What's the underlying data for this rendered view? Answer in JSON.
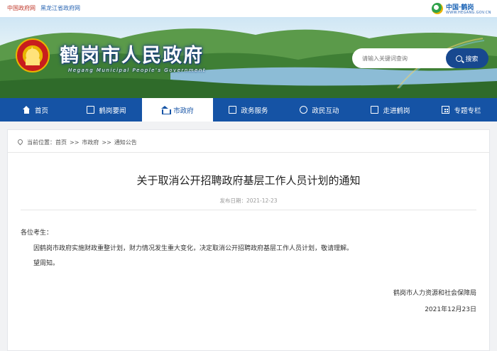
{
  "topbar": {
    "links": [
      "中国政府网",
      "黑龙江省政府网"
    ],
    "brand_name": "中国·鹤岗",
    "brand_url": "WWW.HEGANG.GOV.CN"
  },
  "header": {
    "site_title": "鹤岗市人民政府",
    "site_subtitle": "Hegang Municipal People's Government",
    "search_placeholder": "请输入关键词查询",
    "search_button": "搜索"
  },
  "nav": {
    "items": [
      {
        "label": "首页",
        "icon": "home-icon"
      },
      {
        "label": "鹤岗要闻",
        "icon": "news-icon"
      },
      {
        "label": "市政府",
        "icon": "government-building-icon"
      },
      {
        "label": "政务服务",
        "icon": "service-icon"
      },
      {
        "label": "政民互动",
        "icon": "chat-icon"
      },
      {
        "label": "走进鹤岗",
        "icon": "book-icon"
      },
      {
        "label": "专题专栏",
        "icon": "grid-icon"
      }
    ],
    "active_index": 2
  },
  "breadcrumb": {
    "prefix": "当前位置：",
    "items": [
      "首页",
      "市政府",
      "通知公告"
    ],
    "separator": ">>"
  },
  "article": {
    "title": "关于取消公开招聘政府基层工作人员计划的通知",
    "date_line": "发布日期：2021-12-23",
    "greeting": "各位考生：",
    "body": "因鹤岗市政府实施财政重整计划，财力情况发生重大变化，决定取消公开招聘政府基层工作人员计划，敬请理解。",
    "closing": "望周知。",
    "signer": "鹤岗市人力资源和社会保障局",
    "sign_date": "2021年12月23日"
  },
  "colors": {
    "nav_bg": "#1553a5",
    "search_button": "#17488f",
    "top_link_red": "#c0392b"
  }
}
